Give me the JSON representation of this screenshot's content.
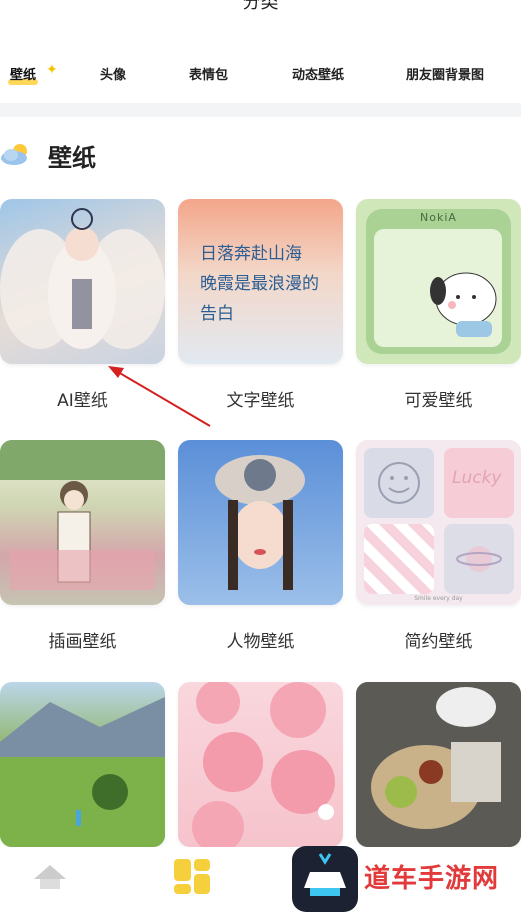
{
  "header": {
    "title": "分类"
  },
  "tabs": [
    {
      "label": "壁纸",
      "active": true
    },
    {
      "label": "头像"
    },
    {
      "label": "表情包"
    },
    {
      "label": "动态壁纸"
    },
    {
      "label": "朋友圈背景图"
    }
  ],
  "section": {
    "title": "壁纸",
    "icon": "cloud-sun-icon"
  },
  "cards": [
    {
      "label": "AI壁纸"
    },
    {
      "label": "文字壁纸",
      "image_text": [
        "日落奔赴山海",
        "晚霞是最浪漫的",
        "告白"
      ]
    },
    {
      "label": "可爱壁纸",
      "image_text": "NokiA"
    },
    {
      "label": "插画壁纸"
    },
    {
      "label": "人物壁纸"
    },
    {
      "label": "简约壁纸",
      "image_text": [
        "Lucky",
        "Smile every day"
      ]
    },
    {
      "label": ""
    },
    {
      "label": ""
    },
    {
      "label": ""
    }
  ],
  "watermark": {
    "brand": "道车手游网"
  },
  "colors": {
    "accent": "#ffd75a",
    "arrow": "#d62020",
    "divider": "#f3f4f6"
  },
  "bottom_nav": [
    "home-icon",
    "category-icon"
  ]
}
